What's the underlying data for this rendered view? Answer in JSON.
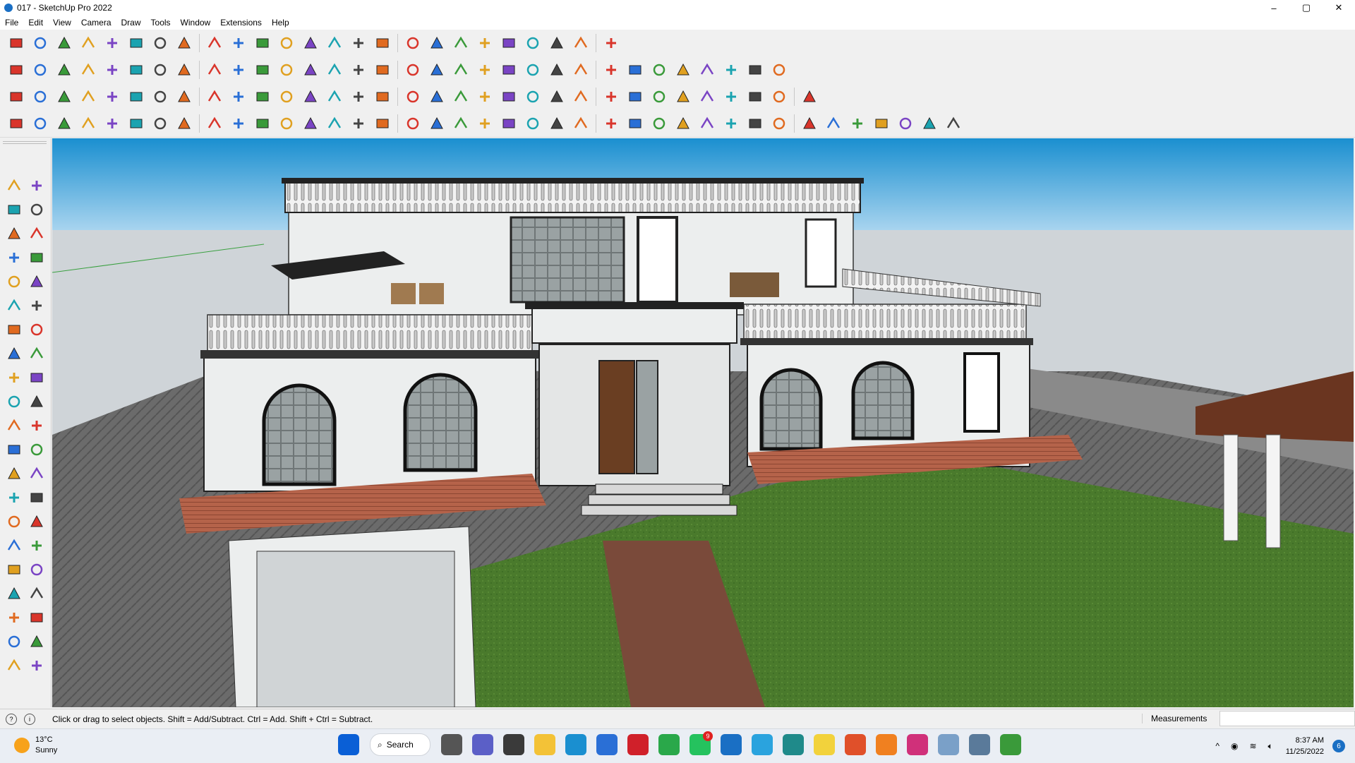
{
  "window": {
    "title": "017 - SketchUp Pro 2022",
    "controls": [
      "–",
      "▢",
      "✕"
    ]
  },
  "menu": [
    "File",
    "Edit",
    "View",
    "Camera",
    "Draw",
    "Tools",
    "Window",
    "Extensions",
    "Help"
  ],
  "colors": {
    "sky_top": "#1a8fd0",
    "sky_mid": "#a8d4ef",
    "horizon": "#cfd4d8",
    "grass": "#4a7a2c",
    "wall": "#eceeee",
    "deck": "#b5634a",
    "roof_rail": "#333333",
    "accent": "#1a6fc4"
  },
  "toolbar_icons": {
    "row1": [
      "zoom-icon",
      "select-icon",
      "eraser-icon",
      "pencil-icon",
      "lasso-icon",
      "paint-icon",
      "pushpull-icon",
      "followme-icon",
      "move-icon",
      "rotate-icon",
      "scale-icon",
      "tape-icon",
      "text-icon",
      "paint-bucket-icon",
      "orbit-icon",
      "pan-icon",
      "zoom-window-icon",
      "zoom-extents-icon",
      "components-icon",
      "layers-icon",
      "tags-icon",
      "styles-icon",
      "scenes-icon",
      "sandbox-icon",
      "extension-icon"
    ],
    "row2": [
      "warehouse-icon",
      "box-icon",
      "cube-icon",
      "xray-icon",
      "wireframe-icon",
      "hidden-line-icon",
      "shaded-icon",
      "textured-icon",
      "monochrome-icon",
      "section-plane-icon",
      "section-fill-icon",
      "section-cut-icon",
      "axes-icon",
      "measure-icon",
      "circle-icon",
      "polygon-icon",
      "ellipse-icon",
      "arc-icon",
      "freehand-icon",
      "offset-icon",
      "intersect-icon",
      "weld-icon",
      "join-icon",
      "export-icon",
      "import-icon",
      "red-arrow-icon",
      "blue-arrow-icon",
      "green-arrow-icon",
      "orange-arrow-icon",
      "purple-arrow-icon",
      "solid-icon",
      "union-icon"
    ],
    "row3": [
      "camera-icon",
      "lamp-icon",
      "sphere-icon",
      "wedge-icon",
      "burst-icon",
      "cone-icon",
      "dome-icon",
      "torus-icon",
      "cylinder-icon",
      "grid-icon",
      "frame-icon",
      "window-icon",
      "door-icon",
      "stair-icon",
      "railing-icon",
      "bezier-icon",
      "spline-icon",
      "curve-icon",
      "knife-icon",
      "fillet-icon",
      "chamfer-icon",
      "hand-icon",
      "fan-icon",
      "cloth-icon",
      "leaf-icon",
      "spring-icon",
      "wave-icon",
      "hammer-icon",
      "stairs-icon",
      "pipe-icon",
      "fence-icon",
      "wall-icon",
      "beam-icon"
    ],
    "row4": [
      "blue-box-icon",
      "cyan-plane-icon",
      "yellow-plane-icon",
      "green-plane-icon",
      "red-plane-icon",
      "stack-icon",
      "spiral-icon",
      "red-square-icon",
      "list-icon",
      "flag-icon",
      "book-icon",
      "link-icon",
      "hook-icon",
      "dotted-curve-icon",
      "red-cross-icon",
      "green-cross-icon",
      "blue-x-icon",
      "cyan-cone-icon",
      "flask-icon",
      "warning-icon",
      "yellow-loop-icon",
      "knot-icon",
      "gear-loop-icon",
      "snowflake-icon",
      "bucket-icon",
      "undo-curve-icon",
      "tree-icon",
      "building-icon",
      "roof-icon",
      "house-icon",
      "tag-icon",
      "group-icon",
      "plan-icon",
      "tile-icon",
      "frame-orange-icon",
      "waffle-icon",
      "close-x-icon",
      "circle-dots-icon",
      "grid-qr-icon"
    ]
  },
  "left_tools": [
    "select-tool-icon",
    "orbit-tool-icon",
    "paint-tool-icon",
    "eraser-tool-icon",
    "components-tool-icon",
    "tape-tool-icon",
    "line-tool-icon",
    "freehand-tool-icon",
    "rectangle-tool-icon",
    "rotated-rect-icon",
    "circle-tool-icon",
    "polygon-tool-icon",
    "arc-tool-icon",
    "pie-tool-icon",
    "arc2-tool-icon",
    "pie2-tool-icon",
    "move-tool-icon",
    "pushpull-tool-icon",
    "rotate-tool-icon",
    "followme-tool-icon",
    "scale-tool-icon",
    "offset-tool-icon",
    "tape-measure-icon",
    "dimension-tool-icon",
    "protractor-tool-icon",
    "text-tool-icon",
    "axes-tool-icon",
    "3dtext-tool-icon",
    "orbit2-tool-icon",
    "pan-tool-icon",
    "zoom-tool-icon",
    "zoom-window-tool-icon",
    "zoom-extents-tool-icon",
    "previous-view-icon",
    "walk-tool-icon",
    "look-around-icon",
    "footprints-icon",
    "position-camera-icon",
    "section-plane-tool-icon",
    "display-section-icon",
    "layers-tool-icon",
    "styles-tool-icon"
  ],
  "status": {
    "hint": "Click or drag to select objects. Shift = Add/Subtract. Ctrl = Add. Shift + Ctrl = Subtract.",
    "measurements_label": "Measurements",
    "measurements_value": ""
  },
  "taskbar": {
    "weather_temp": "13°C",
    "weather_desc": "Sunny",
    "search_label": "Search",
    "apps": [
      "windows-start-icon",
      "task-view-icon",
      "teams-icon",
      "calculator-icon",
      "file-explorer-icon",
      "edge-icon",
      "store-icon",
      "opera-icon",
      "chrome-icon",
      "whatsapp-icon",
      "sketchup-icon",
      "telegram-icon",
      "layout-icon",
      "sticky-notes-icon",
      "grammarly-icon",
      "cloud-icon",
      "instagram-icon",
      "photos-icon",
      "style-builder-icon",
      "earth-icon"
    ],
    "whatsapp_badge": "9",
    "time": "8:37 AM",
    "date": "11/25/2022",
    "notification_count": "6"
  }
}
